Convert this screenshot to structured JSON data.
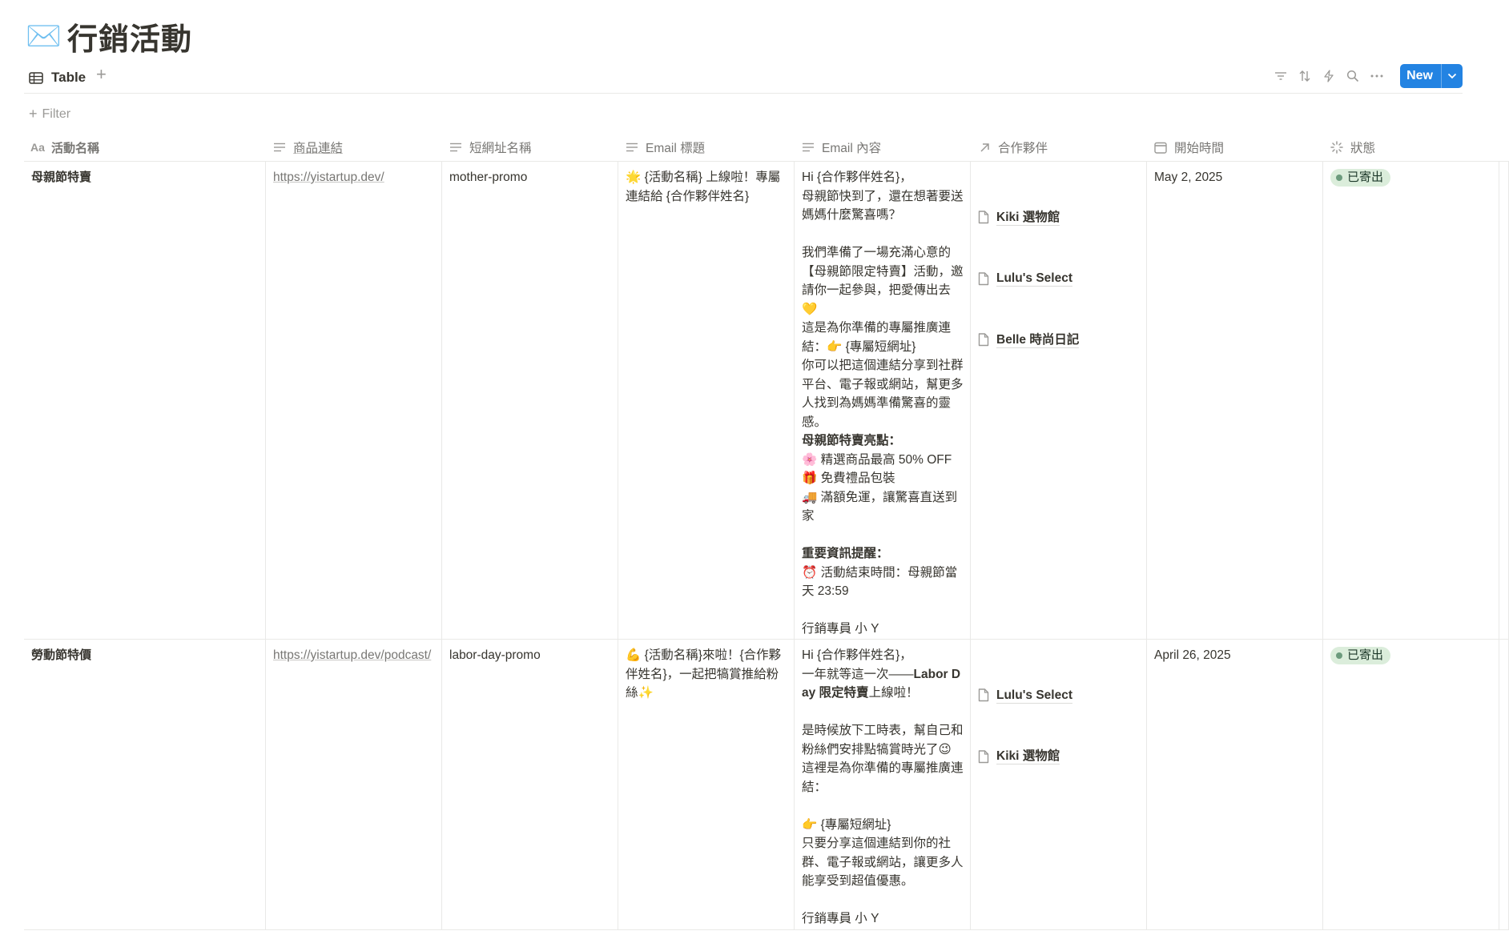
{
  "page": {
    "icon": "✉️",
    "title": "行銷活動"
  },
  "view": {
    "tab_label": "Table",
    "tab_icon": "table-icon",
    "add_view": "+",
    "new_button": "New"
  },
  "toolbar": {
    "icons": [
      "filter-icon",
      "sort-icon",
      "automation-icon",
      "search-icon",
      "more-icon"
    ]
  },
  "filter": {
    "label": "Filter"
  },
  "columns": [
    {
      "label": "活動名稱",
      "icon": "title-aa-icon"
    },
    {
      "label": "商品連結",
      "icon": "text-icon"
    },
    {
      "label": "短網址名稱",
      "icon": "text-icon"
    },
    {
      "label": "Email 標題",
      "icon": "text-icon"
    },
    {
      "label": "Email 內容",
      "icon": "text-icon"
    },
    {
      "label": "合作夥伴",
      "icon": "relation-arrow-icon"
    },
    {
      "label": "開始時間",
      "icon": "calendar-icon"
    },
    {
      "label": "狀態",
      "icon": "status-icon"
    }
  ],
  "rows": [
    {
      "name": "母親節特賣",
      "link": "https://yistartup.dev/",
      "slug": "mother-promo",
      "subject": "🌟 {活動名稱} 上線啦！專屬連結給 {合作夥伴姓名}",
      "body_intro": "Hi {合作夥伴姓名}，\n母親節快到了，還在想著要送媽媽什麼驚喜嗎？\n\n我們準備了一場充滿心意的【母親節限定特賣】活動，邀請你一起參與，把愛傳出去💛\n這是為你準備的專屬推廣連結：👉 {專屬短網址}\n你可以把這個連結分享到社群平台、電子報或網站，幫更多人找到為媽媽準備驚喜的靈感。\n",
      "body_h1": "母親節特賣亮點：",
      "body_list1": "🌸 精選商品最高 50% OFF\n🎁 免費禮品包裝\n🚚 滿額免運，讓驚喜直送到家\n",
      "body_h2": "重要資訊提醒：",
      "body_list2": "⏰ 活動結束時間：母親節當天 23:59\n\n行銷專員 小 Y",
      "partners": [
        "Kiki 選物館",
        "Lulu's Select",
        "Belle 時尚日記"
      ],
      "date": "May 2, 2025",
      "status": "已寄出"
    },
    {
      "name": "勞動節特價",
      "link": "https://yistartup.dev/podcast/",
      "slug": "labor-day-promo",
      "subject": "💪 {活動名稱}來啦！{合作夥伴姓名}，一起把犒賞推給粉絲✨",
      "body_a": "Hi {合作夥伴姓名}，\n一年就等這一次——",
      "body_bold": "Labor Day 限定特賣",
      "body_b": "上線啦！\n\n是時候放下工時表，幫自己和粉絲們安排點犒賞時光了😉\n這裡是為你準備的專屬推廣連結：\n\n👉 {專屬短網址}\n只要分享這個連結到你的社群、電子報或網站，讓更多人能享受到超值優惠。\n\n行銷專員 小 Y",
      "partners": [
        "Lulu's Select",
        "Kiki 選物館"
      ],
      "date": "April 26, 2025",
      "status": "已寄出"
    }
  ],
  "colors": {
    "accent": "#2383e2",
    "status_bg": "#dbeddb",
    "status_dot": "#6c9b7d"
  }
}
